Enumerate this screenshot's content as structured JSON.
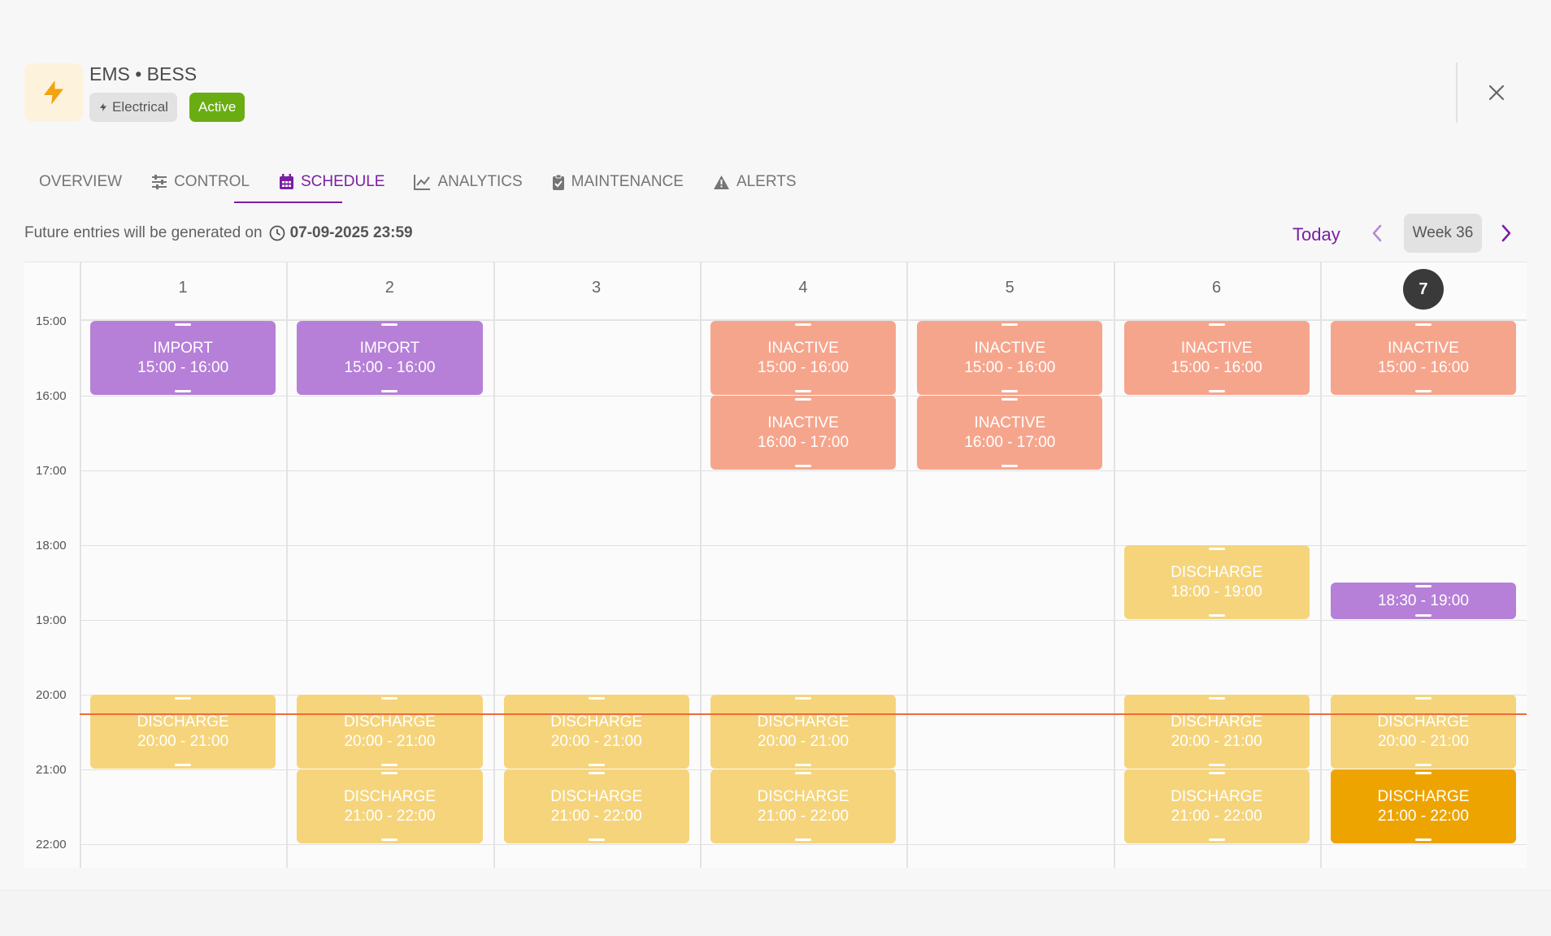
{
  "header": {
    "title": "EMS • BESS",
    "chip_category": "Electrical",
    "chip_status": "Active",
    "colors": {
      "accent": "#7b1fa2",
      "active_chip": "#6aad12",
      "bolt": "#f2a30f"
    }
  },
  "tabs": [
    {
      "label": "OVERVIEW",
      "icon": ""
    },
    {
      "label": "CONTROL",
      "icon": "sliders-icon"
    },
    {
      "label": "SCHEDULE",
      "icon": "calendar-icon"
    },
    {
      "label": "ANALYTICS",
      "icon": "line-chart-icon"
    },
    {
      "label": "MAINTENANCE",
      "icon": "clipboard-icon"
    },
    {
      "label": "ALERTS",
      "icon": "warning-icon"
    }
  ],
  "active_tab": "SCHEDULE",
  "info": {
    "text": "Future entries will be generated on",
    "date": "07-09-2025 23:59"
  },
  "nav": {
    "today_label": "Today",
    "week_label": "Week 36"
  },
  "calendar": {
    "days": [
      "1",
      "2",
      "3",
      "4",
      "5",
      "6",
      "7"
    ],
    "today_day": "7",
    "times": [
      "15:00",
      "16:00",
      "17:00",
      "18:00",
      "19:00",
      "20:00",
      "21:00",
      "22:00"
    ],
    "events": [
      {
        "day": 0,
        "start": 15.0,
        "end": 16.0,
        "title": "IMPORT",
        "time": "15:00 - 16:00",
        "kind": "purple"
      },
      {
        "day": 1,
        "start": 15.0,
        "end": 16.0,
        "title": "IMPORT",
        "time": "15:00 - 16:00",
        "kind": "purple"
      },
      {
        "day": 3,
        "start": 15.0,
        "end": 16.0,
        "title": "INACTIVE",
        "time": "15:00 - 16:00",
        "kind": "salmon"
      },
      {
        "day": 4,
        "start": 15.0,
        "end": 16.0,
        "title": "INACTIVE",
        "time": "15:00 - 16:00",
        "kind": "salmon"
      },
      {
        "day": 5,
        "start": 15.0,
        "end": 16.0,
        "title": "INACTIVE",
        "time": "15:00 - 16:00",
        "kind": "salmon"
      },
      {
        "day": 6,
        "start": 15.0,
        "end": 16.0,
        "title": "INACTIVE",
        "time": "15:00 - 16:00",
        "kind": "salmon"
      },
      {
        "day": 3,
        "start": 16.0,
        "end": 17.0,
        "title": "INACTIVE",
        "time": "16:00 - 17:00",
        "kind": "salmon"
      },
      {
        "day": 4,
        "start": 16.0,
        "end": 17.0,
        "title": "INACTIVE",
        "time": "16:00 - 17:00",
        "kind": "salmon"
      },
      {
        "day": 5,
        "start": 18.0,
        "end": 19.0,
        "title": "DISCHARGE",
        "time": "18:00 - 19:00",
        "kind": "yellow"
      },
      {
        "day": 6,
        "start": 18.5,
        "end": 19.0,
        "title": "",
        "time": "18:30 - 19:00",
        "kind": "purple"
      },
      {
        "day": 0,
        "start": 20.0,
        "end": 21.0,
        "title": "DISCHARGE",
        "time": "20:00 - 21:00",
        "kind": "yellow"
      },
      {
        "day": 1,
        "start": 20.0,
        "end": 21.0,
        "title": "DISCHARGE",
        "time": "20:00 - 21:00",
        "kind": "yellow"
      },
      {
        "day": 2,
        "start": 20.0,
        "end": 21.0,
        "title": "DISCHARGE",
        "time": "20:00 - 21:00",
        "kind": "yellow"
      },
      {
        "day": 3,
        "start": 20.0,
        "end": 21.0,
        "title": "DISCHARGE",
        "time": "20:00 - 21:00",
        "kind": "yellow"
      },
      {
        "day": 5,
        "start": 20.0,
        "end": 21.0,
        "title": "DISCHARGE",
        "time": "20:00 - 21:00",
        "kind": "yellow"
      },
      {
        "day": 6,
        "start": 20.0,
        "end": 21.0,
        "title": "DISCHARGE",
        "time": "20:00 - 21:00",
        "kind": "yellow"
      },
      {
        "day": 1,
        "start": 21.0,
        "end": 22.0,
        "title": "DISCHARGE",
        "time": "21:00 - 22:00",
        "kind": "yellow"
      },
      {
        "day": 2,
        "start": 21.0,
        "end": 22.0,
        "title": "DISCHARGE",
        "time": "21:00 - 22:00",
        "kind": "yellow"
      },
      {
        "day": 3,
        "start": 21.0,
        "end": 22.0,
        "title": "DISCHARGE",
        "time": "21:00 - 22:00",
        "kind": "yellow"
      },
      {
        "day": 5,
        "start": 21.0,
        "end": 22.0,
        "title": "DISCHARGE",
        "time": "21:00 - 22:00",
        "kind": "yellow"
      },
      {
        "day": 6,
        "start": 21.0,
        "end": 22.0,
        "title": "DISCHARGE",
        "time": "21:00 - 22:00",
        "kind": "orange"
      }
    ],
    "current_time_marker": "20:15"
  }
}
